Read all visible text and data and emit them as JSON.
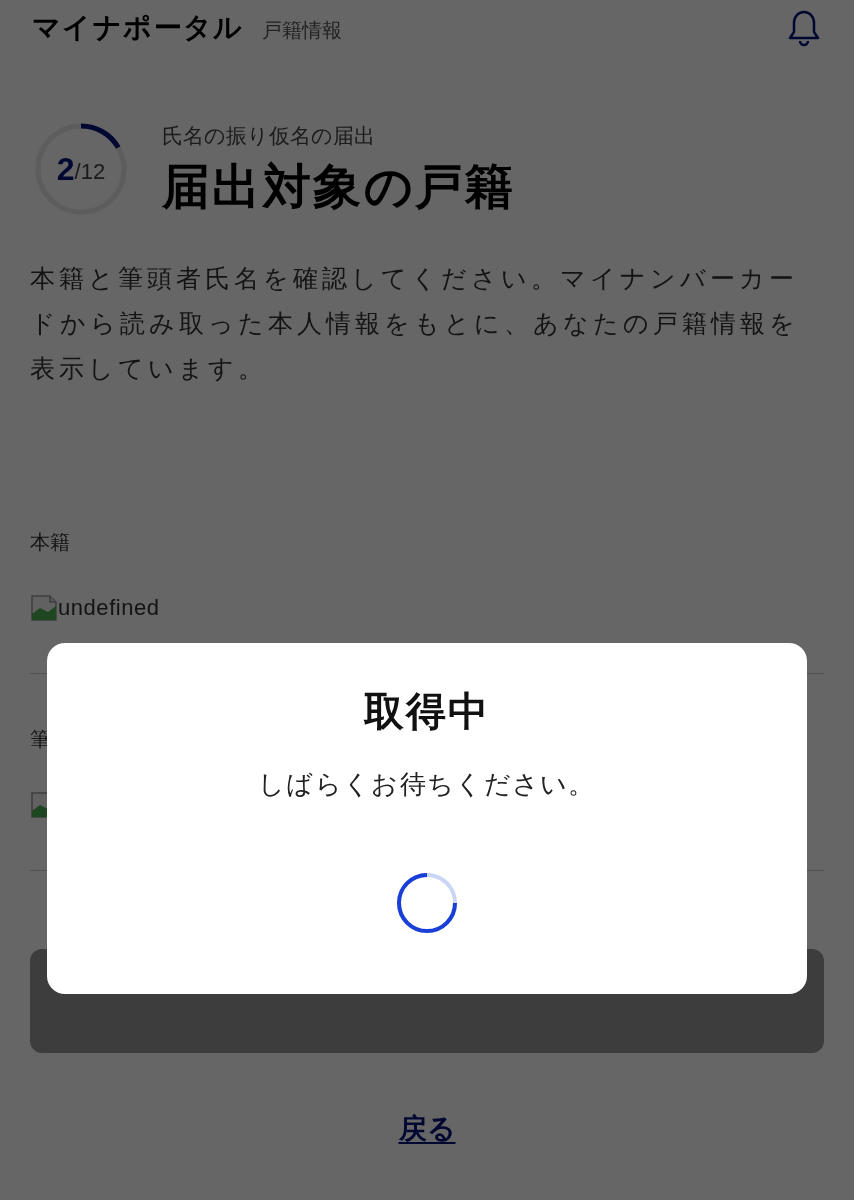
{
  "header": {
    "title": "マイナポータル",
    "subtitle": "戸籍情報"
  },
  "progress": {
    "current": "2",
    "total": "/12",
    "level": 0.1667
  },
  "step_label": "氏名の振り仮名の届出",
  "heading": "届出対象の戸籍",
  "description": "本籍と筆頭者氏名を確認してください。マイナンバーカードから読み取った本人情報をもとに、あなたの戸籍情報を表示しています。",
  "fields": [
    {
      "label": "本籍",
      "value": "undefined"
    },
    {
      "label": "筆"
    }
  ],
  "next_button": {
    "disabled": true
  },
  "back_link": "戻る",
  "dialog": {
    "title": "取得中",
    "message": "しばらくお待ちください。"
  }
}
